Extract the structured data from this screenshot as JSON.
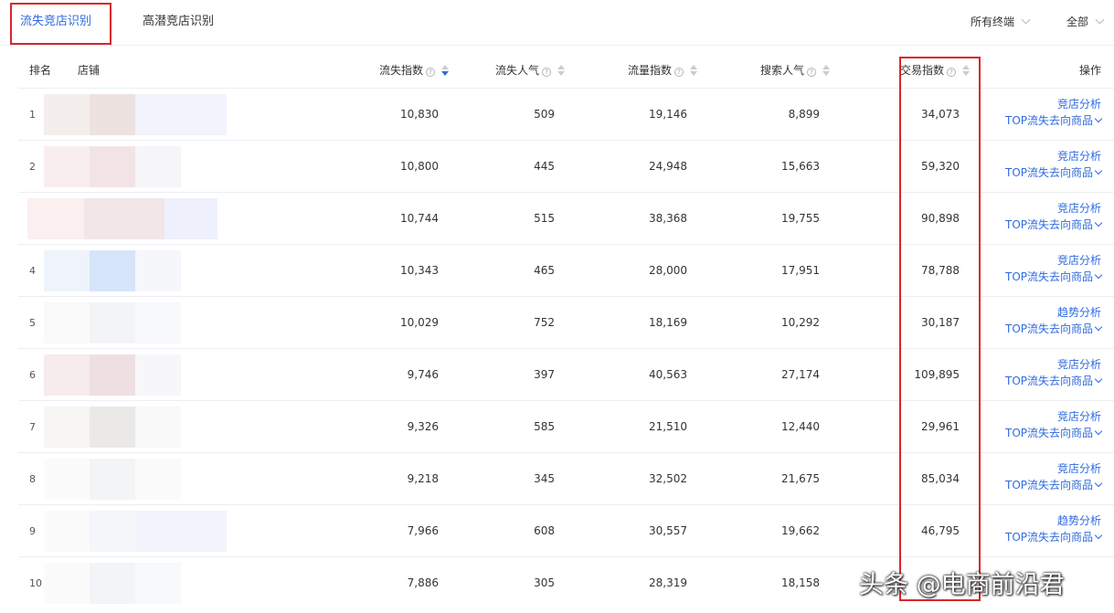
{
  "tabs": [
    {
      "label": "流失竞店识别",
      "active": true
    },
    {
      "label": "高潜竞店识别",
      "active": false
    }
  ],
  "filters": {
    "device": "所有终端",
    "scope": "全部"
  },
  "table": {
    "columns": {
      "rank": "排名",
      "store": "店铺",
      "loss_index": "流失指数",
      "loss_popularity": "流失人气",
      "traffic_index": "流量指数",
      "search_popularity": "搜索人气",
      "trade_index": "交易指数",
      "action": "操作"
    },
    "help_icon": "?",
    "sorted_column": "loss_index",
    "sort_direction": "desc",
    "rows": [
      {
        "rank": "1",
        "loss_index": "10,830",
        "loss_popularity": "509",
        "traffic_index": "19,146",
        "search_popularity": "8,899",
        "trade_index": "34,073",
        "action1": "竞店分析",
        "action2": "TOP流失去向商品"
      },
      {
        "rank": "2",
        "loss_index": "10,800",
        "loss_popularity": "445",
        "traffic_index": "24,948",
        "search_popularity": "15,663",
        "trade_index": "59,320",
        "action1": "竞店分析",
        "action2": "TOP流失去向商品"
      },
      {
        "rank": "",
        "loss_index": "10,744",
        "loss_popularity": "515",
        "traffic_index": "38,368",
        "search_popularity": "19,755",
        "trade_index": "90,898",
        "action1": "竞店分析",
        "action2": "TOP流失去向商品"
      },
      {
        "rank": "4",
        "loss_index": "10,343",
        "loss_popularity": "465",
        "traffic_index": "28,000",
        "search_popularity": "17,951",
        "trade_index": "78,788",
        "action1": "竞店分析",
        "action2": "TOP流失去向商品"
      },
      {
        "rank": "5",
        "loss_index": "10,029",
        "loss_popularity": "752",
        "traffic_index": "18,169",
        "search_popularity": "10,292",
        "trade_index": "30,187",
        "action1": "趋势分析",
        "action2": "TOP流失去向商品"
      },
      {
        "rank": "6",
        "loss_index": "9,746",
        "loss_popularity": "397",
        "traffic_index": "40,563",
        "search_popularity": "27,174",
        "trade_index": "109,895",
        "action1": "竞店分析",
        "action2": "TOP流失去向商品"
      },
      {
        "rank": "7",
        "loss_index": "9,326",
        "loss_popularity": "585",
        "traffic_index": "21,510",
        "search_popularity": "12,440",
        "trade_index": "29,961",
        "action1": "竞店分析",
        "action2": "TOP流失去向商品"
      },
      {
        "rank": "8",
        "loss_index": "9,218",
        "loss_popularity": "345",
        "traffic_index": "32,502",
        "search_popularity": "21,675",
        "trade_index": "85,034",
        "action1": "竞店分析",
        "action2": "TOP流失去向商品"
      },
      {
        "rank": "9",
        "loss_index": "7,966",
        "loss_popularity": "608",
        "traffic_index": "30,557",
        "search_popularity": "19,662",
        "trade_index": "46,795",
        "action1": "趋势分析",
        "action2": "TOP流失去向商品"
      },
      {
        "rank": "10",
        "loss_index": "7,886",
        "loss_popularity": "305",
        "traffic_index": "28,319",
        "search_popularity": "18,158",
        "trade_index": "",
        "action1": "竞店分析",
        "action2": "TOP流失去向商品"
      }
    ]
  },
  "colors": {
    "accent": "#2f6bdf",
    "highlight_box": "#d9252a"
  },
  "watermark": "头条 @电商前沿君"
}
